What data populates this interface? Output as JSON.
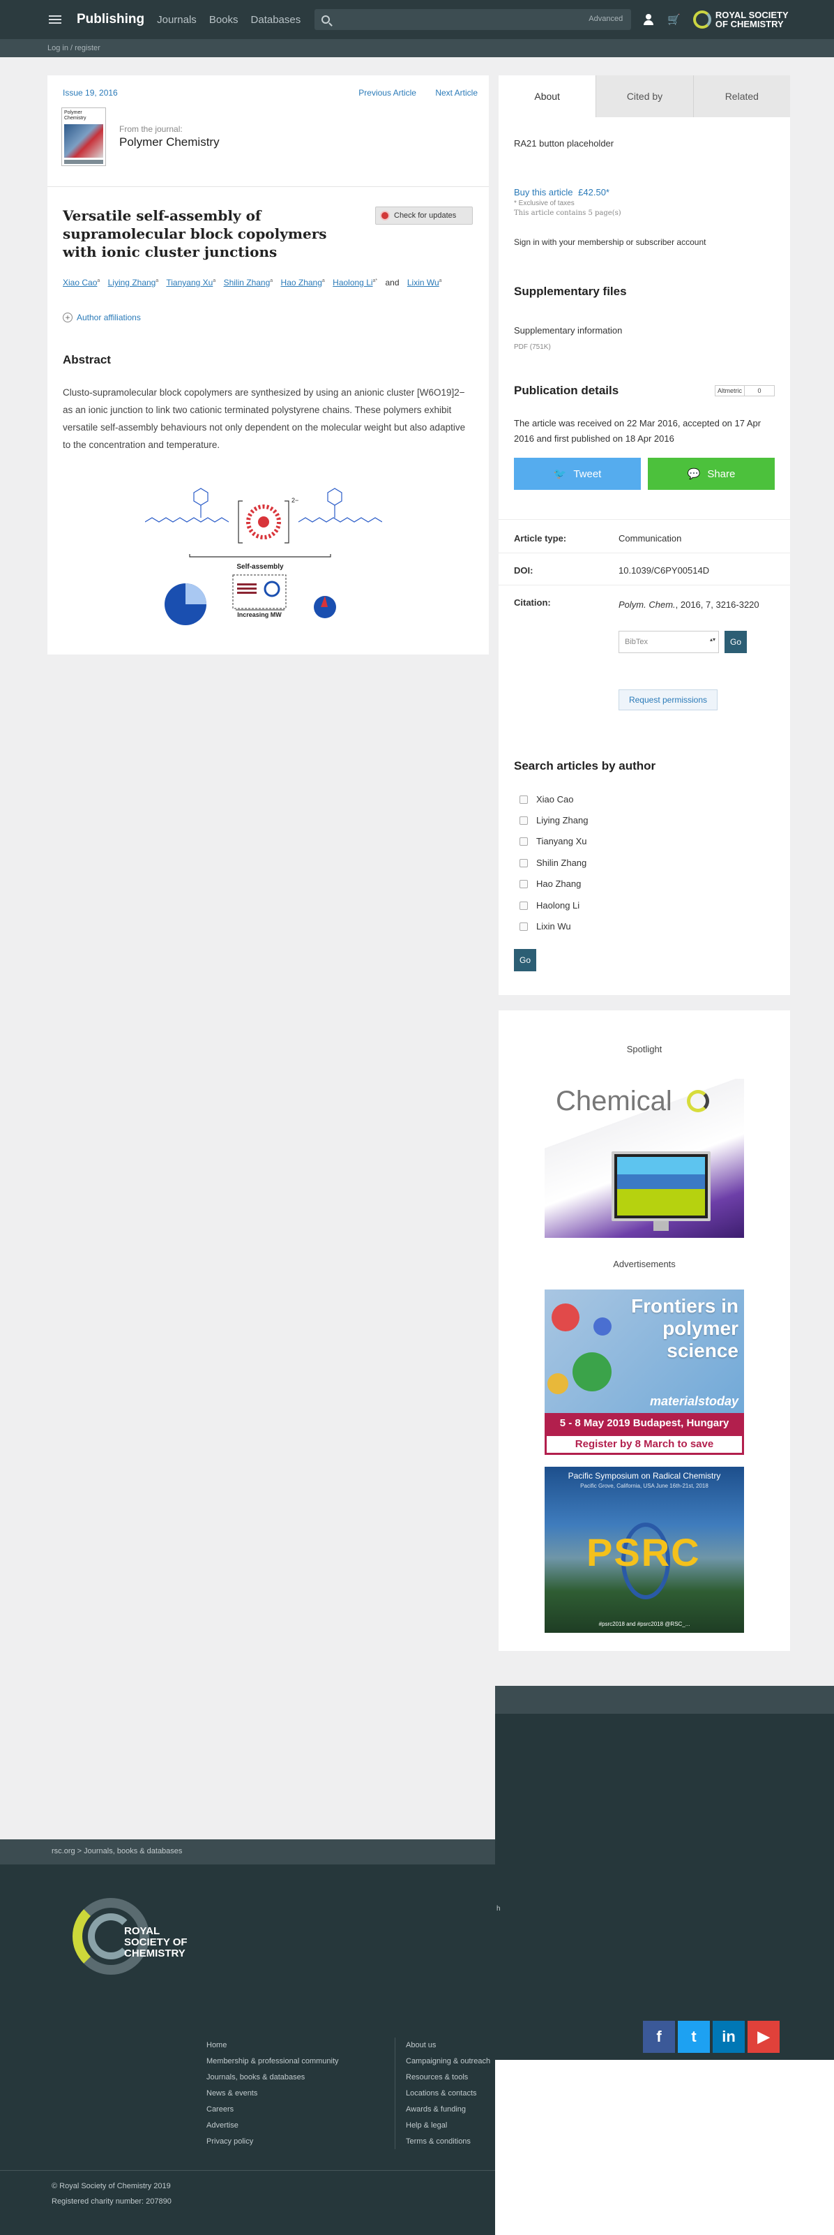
{
  "nav": {
    "brand": "Publishing",
    "links": [
      "Journals",
      "Books",
      "Databases"
    ],
    "search_advanced": "Advanced",
    "logo_text": "ROYAL SOCIETY OF CHEMISTRY",
    "login": "Log in / register"
  },
  "article": {
    "issue": "Issue 19, 2016",
    "prev": "Previous Article",
    "next": "Next Article",
    "cover_text": "Polymer Chemistry",
    "from_journal": "From the journal:",
    "journal": "Polymer Chemistry",
    "title": "Versatile self-assembly of supramolecular block copolymers with ionic cluster junctions",
    "check_updates": "Check for updates",
    "authors": [
      "Xiao Cao",
      "Liying Zhang",
      "Tianyang Xu",
      "Shilin Zhang",
      "Hao Zhang",
      "Haolong Li",
      "Lixin Wu"
    ],
    "author_sup": [
      "a",
      "a",
      "a",
      "a",
      "a",
      "a*",
      "a"
    ],
    "and": "and",
    "affiliations": "Author affiliations",
    "abstract_heading": "Abstract",
    "abstract": "Clusto-supramolecular block copolymers are synthesized by using an anionic cluster [W6O19]2− as an ionic junction to link two cationic terminated polystyrene chains. These polymers exhibit versatile self-assembly behaviours not only dependent on the molecular weight but also adaptive to the concentration and temperature.",
    "toc_self_assembly": "Self-assembly",
    "toc_increasing": "Increasing MW",
    "toc_charge": "2−"
  },
  "sidebar": {
    "tabs": [
      "About",
      "Cited by",
      "Related"
    ],
    "ra21": "RA21 button placeholder",
    "buy": "Buy this article",
    "price": "£42.50*",
    "excl_taxes": "* Exclusive of taxes",
    "pages": "This article contains 5 page(s)",
    "signin": "Sign in with your membership or subscriber account",
    "supp_heading": "Supplementary files",
    "supp_link": "Supplementary information",
    "supp_size": "PDF (751K)",
    "pub_heading": "Publication details",
    "altmetric_label": "Altmetric",
    "altmetric_value": "0",
    "received": "The article was received on 22 Mar 2016, accepted on 17 Apr 2016 and first published on 18 Apr 2016",
    "tweet": "Tweet",
    "share": "Share",
    "type_k": "Article type:",
    "type_v": "Communication",
    "doi_k": "DOI:",
    "doi_v": "10.1039/C6PY00514D",
    "cit_k": "Citation:",
    "cit_journal": "Polym. Chem.",
    "cit_rest": ", 2016, 7, 3216-3220",
    "bibtex": "BibTex",
    "go": "Go",
    "permissions": "Request permissions",
    "search_heading": "Search articles by author",
    "search_authors": [
      "Xiao Cao",
      "Liying Zhang",
      "Tianyang Xu",
      "Shilin Zhang",
      "Hao Zhang",
      "Haolong Li",
      "Lixin Wu"
    ],
    "search_go": "Go"
  },
  "ads": {
    "spotlight": "Spotlight",
    "chem_word": "Chemical",
    "advertisements": "Advertisements",
    "ad1_headline": "Frontiers in polymer science",
    "ad1_brand": "materialstoday",
    "ad1_dates": "5 - 8 May 2019 Budapest, Hungary",
    "ad1_register": "Register by 8 March to save",
    "ad2_title": "Pacific Symposium on Radical Chemistry",
    "ad2_sub": "Pacific Grove, California, USA June 16th-21st, 2018",
    "ad2_name": "PSRC",
    "ad2_footer": "#psrc2018 and #psrc2018 @RSC_..."
  },
  "footer": {
    "top": "rsc.org > Journals, books & databases",
    "logo_text": "ROYAL SOCIETY OF CHEMISTRY",
    "col1": [
      "Home",
      "Membership & professional community",
      "Journals, books & databases",
      "News & events",
      "Careers",
      "Advertise",
      "Privacy policy"
    ],
    "col2": [
      "About us",
      "Campaigning & outreach",
      "Resources & tools",
      "Locations & contacts",
      "Awards & funding",
      "Help & legal",
      "Terms & conditions"
    ],
    "social": [
      "f",
      "t",
      "in",
      "▶"
    ],
    "copyright": "© Royal Society of Chemistry 2019",
    "charity": "Registered charity number: 207890",
    "h_mark": "h"
  }
}
